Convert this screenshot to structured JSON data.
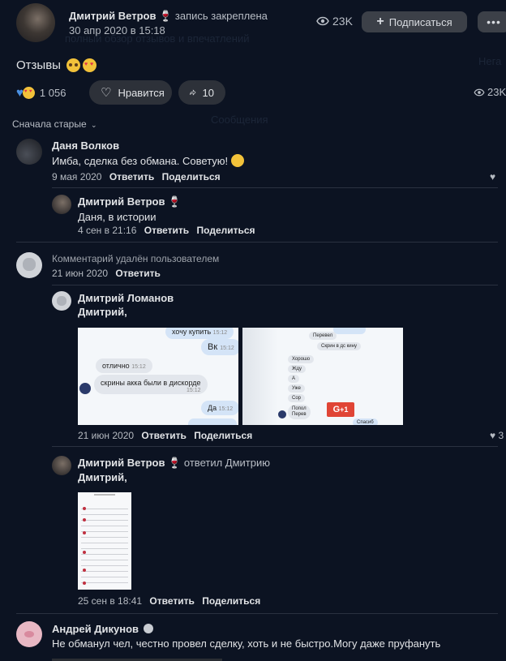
{
  "post": {
    "author": "Дмитрий Ветров",
    "pinned_label": "запись закреплена",
    "date": "30 апр 2020 в 15:18",
    "views": "23K",
    "subscribe_label": "Подписаться",
    "text": "Отзывы",
    "reaction_count": "1 056",
    "like_label": "Нравится",
    "share_count": "10",
    "right_views": "23K"
  },
  "sort_label": "Сначала старые",
  "comments": [
    {
      "name": "Даня Волков",
      "text": "Имба, сделка без обмана. Советую!",
      "date": "9 мая 2020",
      "reply": "Ответить",
      "share": "Поделиться"
    },
    {
      "name": "Дмитрий Ветров",
      "text": "Даня, в истории",
      "date": "4 сен в 21:16",
      "reply": "Ответить",
      "share": "Поделиться"
    },
    {
      "deleted": "Комментарий удалён пользователем",
      "date": "21 июн 2020",
      "reply": "Ответить"
    },
    {
      "name": "Дмитрий Ломанов",
      "text": "Дмитрий,",
      "date": "21 июн 2020",
      "reply": "Ответить",
      "share": "Поделиться",
      "chat1": {
        "b1": "хочу купить",
        "t1": "15:12",
        "b2": "Вк",
        "t2": "15:12",
        "b3": "отлично",
        "t3": "15:12",
        "b4": "скрины акка были в дискорде",
        "t4": "15:12",
        "b5": "Да",
        "t5": "15:12"
      },
      "chat2": {
        "b1": "Перевел",
        "b2": "Скрин в дс кину",
        "b3": "Хорошо",
        "b4": "Жду",
        "b5": "А",
        "b6": "Уже",
        "b7": "Сор",
        "b8": "Попол",
        "b9": "Перев",
        "b10": "Спасиб",
        "badge": "+1"
      },
      "right_count": "3"
    },
    {
      "name": "Дмитрий Ветров",
      "replied": "ответил Дмитрию",
      "text": "Дмитрий,",
      "date": "25 сен в 18:41",
      "reply": "Ответить",
      "share": "Поделиться"
    },
    {
      "name": "Андрей Дикунов",
      "text": "Не обманул чел, честно провел сделку, хоть и не быстро.Могу даже пруфануть"
    }
  ],
  "colors": {
    "background": "#0c1322",
    "button": "#3c4048",
    "text": "#e1e3e6",
    "muted": "#b5bac1"
  }
}
